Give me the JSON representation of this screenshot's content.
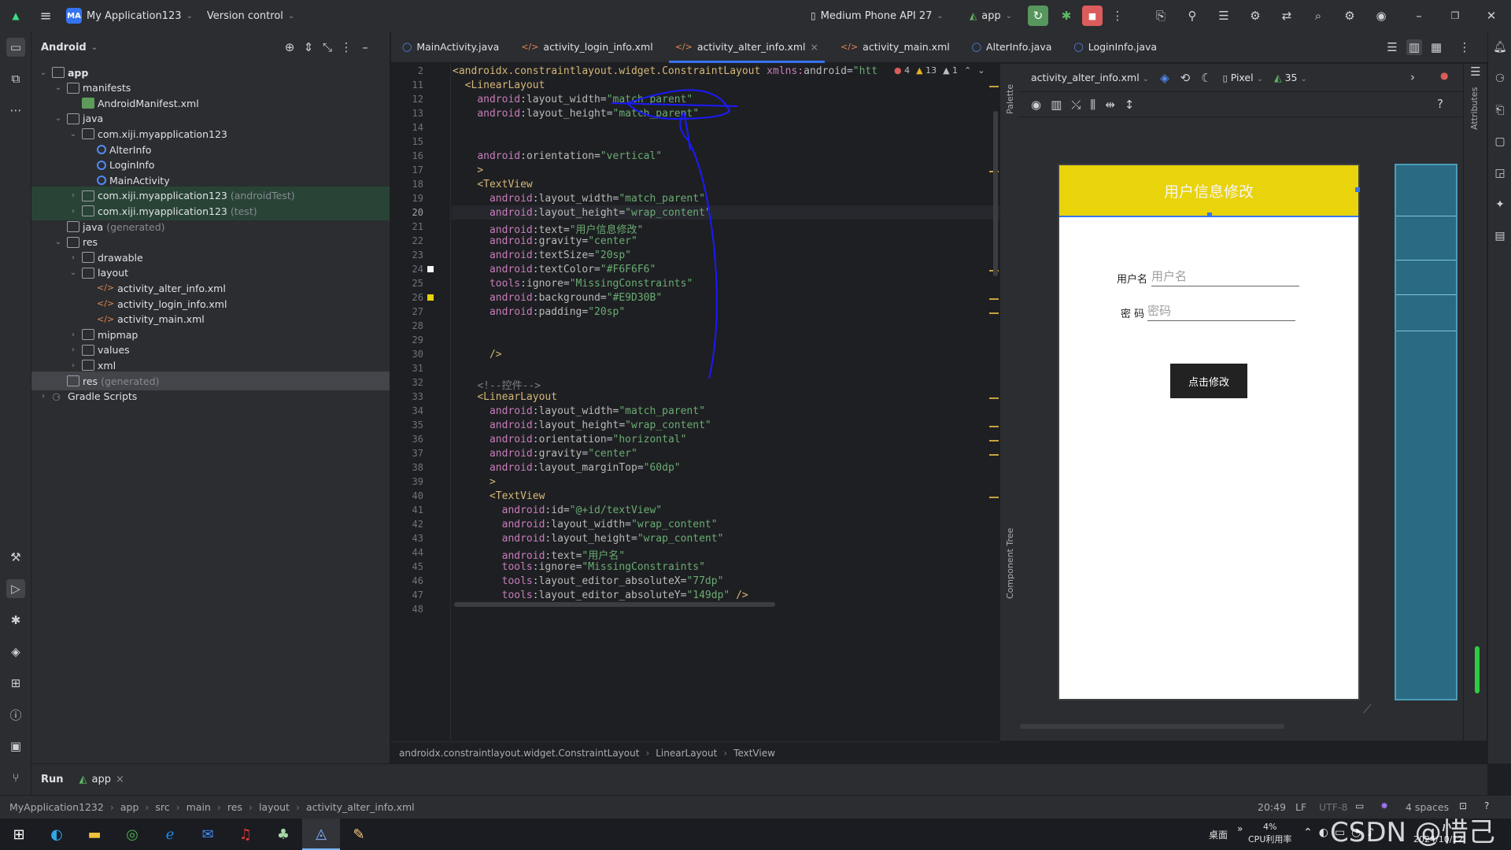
{
  "titlebar": {
    "project_badge": "MA",
    "project_name": "My Application123",
    "vcs": "Version control",
    "device": "Medium Phone API 27",
    "run_config": "app"
  },
  "project_panel": {
    "view": "Android",
    "tree": [
      {
        "label": "app",
        "depth": 0,
        "arrow": "⌄",
        "icon": "module",
        "bold": true
      },
      {
        "label": "manifests",
        "depth": 1,
        "arrow": "⌄",
        "icon": "folder"
      },
      {
        "label": "AndroidManifest.xml",
        "depth": 2,
        "arrow": "",
        "icon": "manifest"
      },
      {
        "label": "java",
        "depth": 1,
        "arrow": "⌄",
        "icon": "folder"
      },
      {
        "label": "com.xiji.myapplication123",
        "depth": 2,
        "arrow": "⌄",
        "icon": "package"
      },
      {
        "label": "AlterInfo",
        "depth": 3,
        "arrow": "",
        "icon": "class"
      },
      {
        "label": "LoginInfo",
        "depth": 3,
        "arrow": "",
        "icon": "class"
      },
      {
        "label": "MainActivity",
        "depth": 3,
        "arrow": "",
        "icon": "class"
      },
      {
        "label": "com.xiji.myapplication123",
        "suffix": "(androidTest)",
        "depth": 2,
        "arrow": "›",
        "icon": "package",
        "hl": true
      },
      {
        "label": "com.xiji.myapplication123",
        "suffix": "(test)",
        "depth": 2,
        "arrow": "›",
        "icon": "package",
        "hl": true
      },
      {
        "label": "java",
        "suffix": "(generated)",
        "depth": 1,
        "arrow": "",
        "icon": "folder"
      },
      {
        "label": "res",
        "depth": 1,
        "arrow": "⌄",
        "icon": "folder"
      },
      {
        "label": "drawable",
        "depth": 2,
        "arrow": "›",
        "icon": "package"
      },
      {
        "label": "layout",
        "depth": 2,
        "arrow": "⌄",
        "icon": "package"
      },
      {
        "label": "activity_alter_info.xml",
        "depth": 3,
        "arrow": "",
        "icon": "xml"
      },
      {
        "label": "activity_login_info.xml",
        "depth": 3,
        "arrow": "",
        "icon": "xml"
      },
      {
        "label": "activity_main.xml",
        "depth": 3,
        "arrow": "",
        "icon": "xml"
      },
      {
        "label": "mipmap",
        "depth": 2,
        "arrow": "›",
        "icon": "package"
      },
      {
        "label": "values",
        "depth": 2,
        "arrow": "›",
        "icon": "package"
      },
      {
        "label": "xml",
        "depth": 2,
        "arrow": "›",
        "icon": "package"
      },
      {
        "label": "res",
        "suffix": "(generated)",
        "depth": 1,
        "arrow": "",
        "icon": "folder",
        "sel": true
      },
      {
        "label": "Gradle Scripts",
        "depth": 0,
        "arrow": "›",
        "icon": "gradle"
      }
    ]
  },
  "tabs": [
    {
      "label": "MainActivity.java",
      "icon": "class"
    },
    {
      "label": "activity_login_info.xml",
      "icon": "xml"
    },
    {
      "label": "activity_alter_info.xml",
      "icon": "xml",
      "active": true,
      "close": "×"
    },
    {
      "label": "activity_main.xml",
      "icon": "xml"
    },
    {
      "label": "AlterInfo.java",
      "icon": "class"
    },
    {
      "label": "LoginInfo.java",
      "icon": "class"
    }
  ],
  "editor": {
    "inspections": {
      "errors": "4",
      "warnings": "13",
      "weak": "1"
    },
    "lines": [
      {
        "n": "2",
        "html": "<span class='tg'>&lt;androidx.constraintlayout.widget.ConstraintLayout</span> <span class='ns'>xmlns:</span><span class='at'>android</span>=<span class='vl'>\"htt</span>"
      },
      {
        "n": "11",
        "html": "  <span class='tg'>&lt;LinearLayout</span>"
      },
      {
        "n": "12",
        "html": "    <span class='ns'>android</span>:<span class='at'>layout_width</span>=<span class='vl'>\"match_parent\"</span>"
      },
      {
        "n": "13",
        "html": "    <span class='ns'>android</span>:<span class='at'>layout_height</span>=<span class='vl'>\"match_parent\"</span>"
      },
      {
        "n": "14",
        "html": ""
      },
      {
        "n": "15",
        "html": ""
      },
      {
        "n": "16",
        "html": "    <span class='ns'>android</span>:<span class='at'>orientation</span>=<span class='vl'>\"vertical\"</span>"
      },
      {
        "n": "17",
        "html": "    <span class='tg'>&gt;</span>"
      },
      {
        "n": "18",
        "html": "    <span class='tg'>&lt;TextView</span>"
      },
      {
        "n": "19",
        "html": "      <span class='ns'>android</span>:<span class='at'>layout_width</span>=<span class='vl'>\"match_parent\"</span>"
      },
      {
        "n": "20",
        "html": "      <span class='ns'>android</span>:<span class='at'>layout_height</span>=<span class='vl'>\"wrap_content\"</span>",
        "cur": true
      },
      {
        "n": "21",
        "html": "      <span class='ns'>android</span>:<span class='at'>text</span>=<span class='vl'>\"用户信息修改\"</span>"
      },
      {
        "n": "22",
        "html": "      <span class='ns'>android</span>:<span class='at'>gravity</span>=<span class='vl'>\"center\"</span>"
      },
      {
        "n": "23",
        "html": "      <span class='ns'>android</span>:<span class='at'>textSize</span>=<span class='vl'>\"20sp\"</span>"
      },
      {
        "n": "24",
        "html": "      <span class='ns'>android</span>:<span class='at'>textColor</span>=<span class='vl'>\"#F6F6F6\"</span>"
      },
      {
        "n": "25",
        "html": "      <span class='ns'>tools</span>:<span class='at'>ignore</span>=<span class='vl'>\"MissingConstraints\"</span>"
      },
      {
        "n": "26",
        "html": "      <span class='ns'>android</span>:<span class='at'>background</span>=<span class='vl'>\"#E9D30B\"</span>"
      },
      {
        "n": "27",
        "html": "      <span class='ns'>android</span>:<span class='at'>padding</span>=<span class='vl'>\"20sp\"</span>"
      },
      {
        "n": "28",
        "html": ""
      },
      {
        "n": "29",
        "html": ""
      },
      {
        "n": "30",
        "html": "      <span class='tg'>/&gt;</span>"
      },
      {
        "n": "31",
        "html": ""
      },
      {
        "n": "32",
        "html": "    <span class='cm'>&lt;!--控件--&gt;</span>"
      },
      {
        "n": "33",
        "html": "    <span class='tg'>&lt;LinearLayout</span>"
      },
      {
        "n": "34",
        "html": "      <span class='ns'>android</span>:<span class='at'>layout_width</span>=<span class='vl'>\"match_parent\"</span>"
      },
      {
        "n": "35",
        "html": "      <span class='ns'>android</span>:<span class='at'>layout_height</span>=<span class='vl'>\"wrap_content\"</span>"
      },
      {
        "n": "36",
        "html": "      <span class='ns'>android</span>:<span class='at'>orientation</span>=<span class='vl'>\"horizontal\"</span>"
      },
      {
        "n": "37",
        "html": "      <span class='ns'>android</span>:<span class='at'>gravity</span>=<span class='vl'>\"center\"</span>"
      },
      {
        "n": "38",
        "html": "      <span class='ns'>android</span>:<span class='at'>layout_marginTop</span>=<span class='vl'>\"60dp\"</span>"
      },
      {
        "n": "39",
        "html": "      <span class='tg'>&gt;</span>"
      },
      {
        "n": "40",
        "html": "      <span class='tg'>&lt;TextView</span>"
      },
      {
        "n": "41",
        "html": "        <span class='ns'>android</span>:<span class='at'>id</span>=<span class='vl'>\"@+id/textView\"</span>"
      },
      {
        "n": "42",
        "html": "        <span class='ns'>android</span>:<span class='at'>layout_width</span>=<span class='vl'>\"wrap_content\"</span>"
      },
      {
        "n": "43",
        "html": "        <span class='ns'>android</span>:<span class='at'>layout_height</span>=<span class='vl'>\"wrap_content\"</span>"
      },
      {
        "n": "44",
        "html": "        <span class='ns'>android</span>:<span class='at'>text</span>=<span class='vl'>\"用户名\"</span>"
      },
      {
        "n": "45",
        "html": "        <span class='ns'>tools</span>:<span class='at'>ignore</span>=<span class='vl'>\"MissingConstraints\"</span>"
      },
      {
        "n": "46",
        "html": "        <span class='ns'>tools</span>:<span class='at'>layout_editor_absoluteX</span>=<span class='vl'>\"77dp\"</span>"
      },
      {
        "n": "47",
        "html": "        <span class='ns'>tools</span>:<span class='at'>layout_editor_absoluteY</span>=<span class='vl'>\"149dp\"</span> <span class='tg'>/&gt;</span>"
      },
      {
        "n": "48",
        "html": ""
      }
    ]
  },
  "breadcrumb": [
    "androidx.constraintlayout.widget.ConstraintLayout",
    "LinearLayout",
    "TextView"
  ],
  "side_labels": {
    "palette": "Palette",
    "component_tree": "Component Tree",
    "attributes": "Attributes"
  },
  "design": {
    "file": "activity_alter_info.xml",
    "device": "Pixel",
    "api": "35",
    "preview": {
      "header": "用户信息修改",
      "header_bg": "#E9D30B",
      "username_label": "用户名",
      "username_hint": "用户名",
      "password_label": "密 码",
      "password_hint": "密码",
      "button": "点击修改"
    }
  },
  "runbar": {
    "run": "Run",
    "config": "app"
  },
  "statusbar": {
    "path": [
      "MyApplication1232",
      "app",
      "src",
      "main",
      "res",
      "layout",
      "activity_alter_info.xml"
    ],
    "position": "20:49",
    "line_sep": "LF",
    "encoding": "UTF-8",
    "indent": "4 spaces"
  },
  "taskbar": {
    "desktop": "桌面",
    "cpu": "4%",
    "cpu_label": "CPU利用率",
    "date": "2024/10/12",
    "watermark": "CSDN @惜己"
  }
}
